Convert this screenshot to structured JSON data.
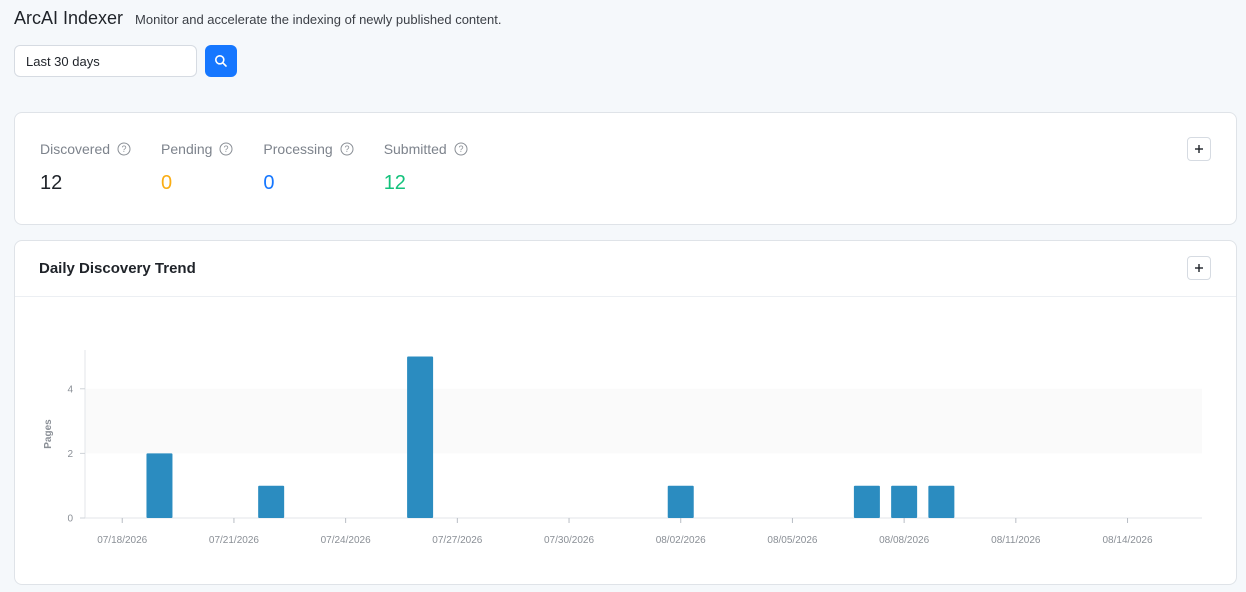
{
  "app": {
    "title": "ArcAI Indexer",
    "subtitle": "Monitor and accelerate the indexing of newly published content."
  },
  "filter": {
    "range_value": "Last 30 days",
    "search_icon": "search-icon"
  },
  "stats": [
    {
      "label": "Discovered",
      "value": "12",
      "color": "#1f2329"
    },
    {
      "label": "Pending",
      "value": "0",
      "color": "#faad14"
    },
    {
      "label": "Processing",
      "value": "0",
      "color": "#1677ff"
    },
    {
      "label": "Submitted",
      "value": "12",
      "color": "#13c27c"
    }
  ],
  "colors": {
    "accent": "#1677ff",
    "bar": "#2b8cc0"
  },
  "chart_card": {
    "title": "Daily Discovery Trend"
  },
  "chart_data": {
    "type": "bar",
    "title": "Daily Discovery Trend",
    "xlabel": "",
    "ylabel": "Pages",
    "ylim": [
      0,
      5.2
    ],
    "yticks": [
      0,
      2,
      4
    ],
    "xticks": [
      "07/18/2026",
      "07/21/2026",
      "07/24/2026",
      "07/27/2026",
      "07/30/2026",
      "08/02/2026",
      "08/05/2026",
      "08/08/2026",
      "08/11/2026",
      "08/14/2026"
    ],
    "x_range": [
      "07/17/2026",
      "08/16/2026"
    ],
    "grid": "horizontal-bands",
    "bars": [
      {
        "date": "07/19/2026",
        "value": 2
      },
      {
        "date": "07/22/2026",
        "value": 1
      },
      {
        "date": "07/26/2026",
        "value": 5
      },
      {
        "date": "08/02/2026",
        "value": 1
      },
      {
        "date": "08/07/2026",
        "value": 1
      },
      {
        "date": "08/08/2026",
        "value": 1
      },
      {
        "date": "08/09/2026",
        "value": 1
      }
    ]
  }
}
